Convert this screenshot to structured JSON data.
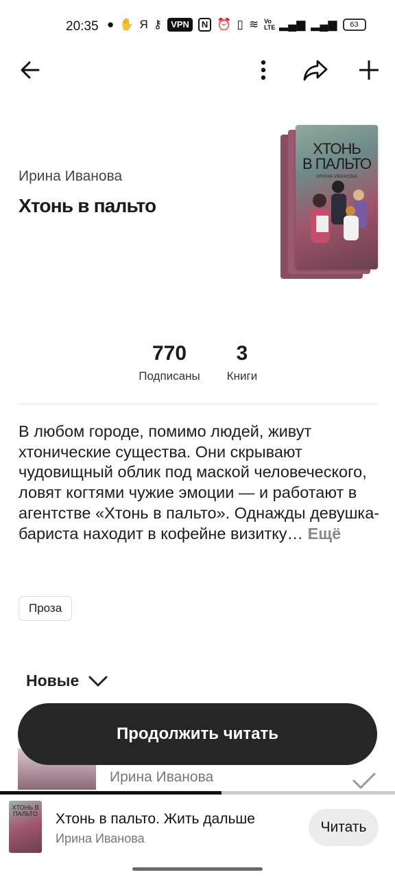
{
  "status_bar": {
    "time": "20:35",
    "icons": [
      "message-icon",
      "gesture-icon",
      "yandex-icon",
      "key-icon",
      "vpn-icon",
      "nfc-icon",
      "alarm-icon",
      "vibrate-icon",
      "wifi-icon",
      "volte-icon",
      "signal-icon",
      "signal-icon"
    ],
    "vpn": "VPN",
    "nfc": "N",
    "volte": "Vo LTE",
    "ya": "Я",
    "battery": "63"
  },
  "book": {
    "author": "Ирина Иванова",
    "title": "Хтонь в пальто",
    "cover_title_line1": "ХТОНЬ",
    "cover_title_line2": "В ПАЛЬТО",
    "cover_author": "ИРИНА ИВАНОВА"
  },
  "stats": [
    {
      "value": "770",
      "label": "Подписаны"
    },
    {
      "value": "3",
      "label": "Книги"
    }
  ],
  "description": "В любом городе, помимо людей, живут хтонические существа. Они скрывают чудовищный облик под маской человеческого, ловят когтями чужие эмоции — и работают в агентстве «Хтонь в пальто». Однажды девушка-бариста находит в кофейне визитку…",
  "more_label": "Ещё",
  "tag": "Проза",
  "sort_label": "Новые",
  "cta_label": "Продолжить читать",
  "list_peek": {
    "author": "Ирина Иванова"
  },
  "player": {
    "title": "Хтонь в пальто. Жить дальше",
    "author": "Ирина Иванова",
    "read_label": "Читать",
    "progress": 0.56,
    "cover_text": "ХТОНЬ В ПАЛЬТО"
  }
}
